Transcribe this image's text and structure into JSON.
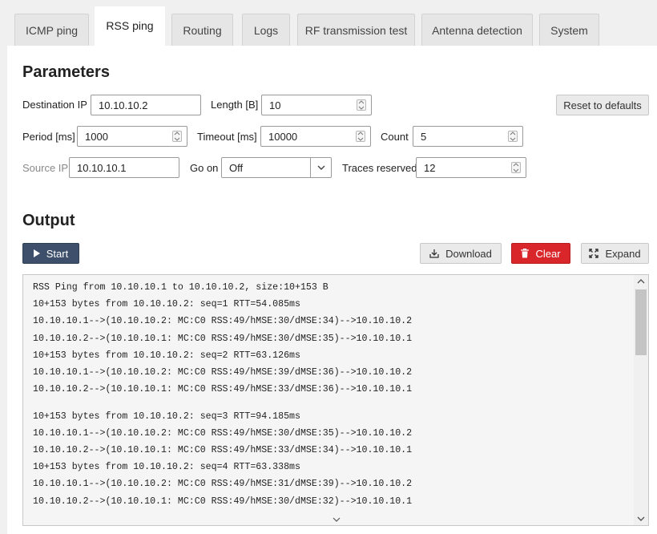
{
  "tabs": [
    {
      "label": "ICMP ping",
      "active": false
    },
    {
      "label": "RSS ping",
      "active": true
    },
    {
      "label": "Routing",
      "active": false
    },
    {
      "label": "Logs",
      "active": false
    },
    {
      "label": "RF transmission test",
      "active": false
    },
    {
      "label": "Antenna detection",
      "active": false
    },
    {
      "label": "System",
      "active": false
    }
  ],
  "parameters": {
    "title": "Parameters",
    "destination_ip": {
      "label": "Destination IP",
      "value": "10.10.10.2"
    },
    "length": {
      "label": "Length [B]",
      "value": "10"
    },
    "reset_label": "Reset to defaults",
    "period": {
      "label": "Period [ms]",
      "value": "1000"
    },
    "timeout": {
      "label": "Timeout [ms]",
      "value": "10000"
    },
    "count": {
      "label": "Count",
      "value": "5"
    },
    "source_ip": {
      "label": "Source IP",
      "value": "10.10.10.1",
      "disabled": true
    },
    "go_on": {
      "label": "Go on",
      "value": "Off"
    },
    "traces_reserved": {
      "label": "Traces reserved",
      "value": "12"
    }
  },
  "output": {
    "title": "Output",
    "start_label": "Start",
    "download_label": "Download",
    "clear_label": "Clear",
    "expand_label": "Expand",
    "lines": [
      "RSS Ping from 10.10.10.1 to 10.10.10.2, size:10+153 B",
      "10+153 bytes from 10.10.10.2: seq=1 RTT=54.085ms",
      "10.10.10.1-->(10.10.10.2: MC:C0 RSS:49/hMSE:30/dMSE:34)-->10.10.10.2",
      "10.10.10.2-->(10.10.10.1: MC:C0 RSS:49/hMSE:30/dMSE:35)-->10.10.10.1",
      "10+153 bytes from 10.10.10.2: seq=2 RTT=63.126ms",
      "10.10.10.1-->(10.10.10.2: MC:C0 RSS:49/hMSE:39/dMSE:36)-->10.10.10.2",
      "10.10.10.2-->(10.10.10.1: MC:C0 RSS:49/hMSE:33/dMSE:36)-->10.10.10.1",
      "",
      "10+153 bytes from 10.10.10.2: seq=3 RTT=94.185ms",
      "10.10.10.1-->(10.10.10.2: MC:C0 RSS:49/hMSE:30/dMSE:35)-->10.10.10.2",
      "10.10.10.2-->(10.10.10.1: MC:C0 RSS:49/hMSE:33/dMSE:34)-->10.10.10.1",
      "10+153 bytes from 10.10.10.2: seq=4 RTT=63.338ms",
      "10.10.10.1-->(10.10.10.2: MC:C0 RSS:49/hMSE:31/dMSE:39)-->10.10.10.2",
      "10.10.10.2-->(10.10.10.1: MC:C0 RSS:49/hMSE:30/dMSE:32)-->10.10.10.1"
    ]
  },
  "icons": {
    "start": "play-icon",
    "download": "download-icon",
    "clear": "trash-icon",
    "expand": "expand-icon",
    "go_on": "chevron-down-icon"
  },
  "colors": {
    "start_button": "#3e4f6b",
    "clear_button": "#d9262a",
    "panel_background": "#ffffff",
    "page_background": "#f0f0f0"
  }
}
